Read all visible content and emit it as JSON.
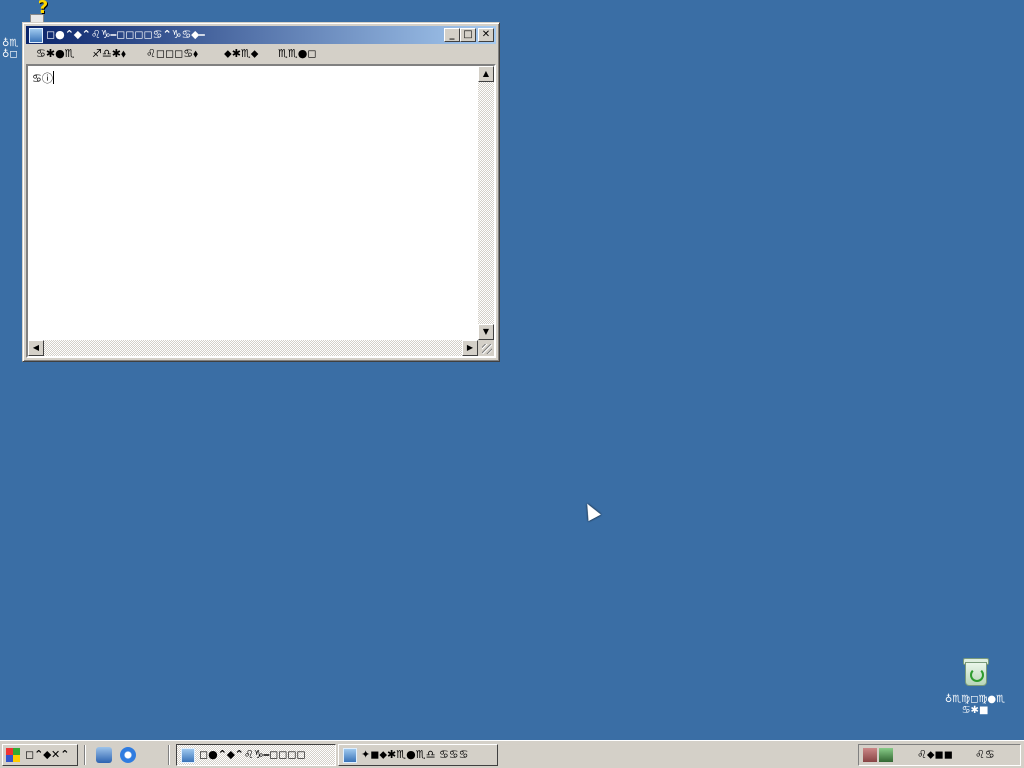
{
  "desktop": {
    "help_icon_label": "♁♏\n♁◻",
    "recycle_bin_label": "♁♏♍◻♍●♏\n♋✱■"
  },
  "window": {
    "title": "◻●⌃⬥⌃♌♑⎯◻◻◻◻♋⌃♑♋⬥⎯",
    "minimize": "_",
    "maximize": "□",
    "close": "✕",
    "menu": [
      "♋✱●♏",
      "♐♎✱⬧",
      "♌◻◻◻♋⬧",
      "⬥✱♏⬥",
      "♏♏●◻"
    ],
    "content": "♋ⓘ"
  },
  "scrollbar": {
    "up": "▲",
    "down": "▼",
    "left": "◀",
    "right": "▶"
  },
  "taskbar": {
    "start_label": "◻⌃⬥✕⌃",
    "task_1": "◻●⌃⬥⌃♌♑⎯◻◻◻◻",
    "task_2": "✦◼⬥✱♏●♏♎ ♋♋♋",
    "tray_lang": "♌⬥◼◼",
    "tray_clock": "♌♋"
  },
  "colors": {
    "desktop": "#3a6ea5",
    "titlebar_start": "#0a246a",
    "titlebar_end": "#a6caf0",
    "chrome": "#d4d0c8"
  }
}
